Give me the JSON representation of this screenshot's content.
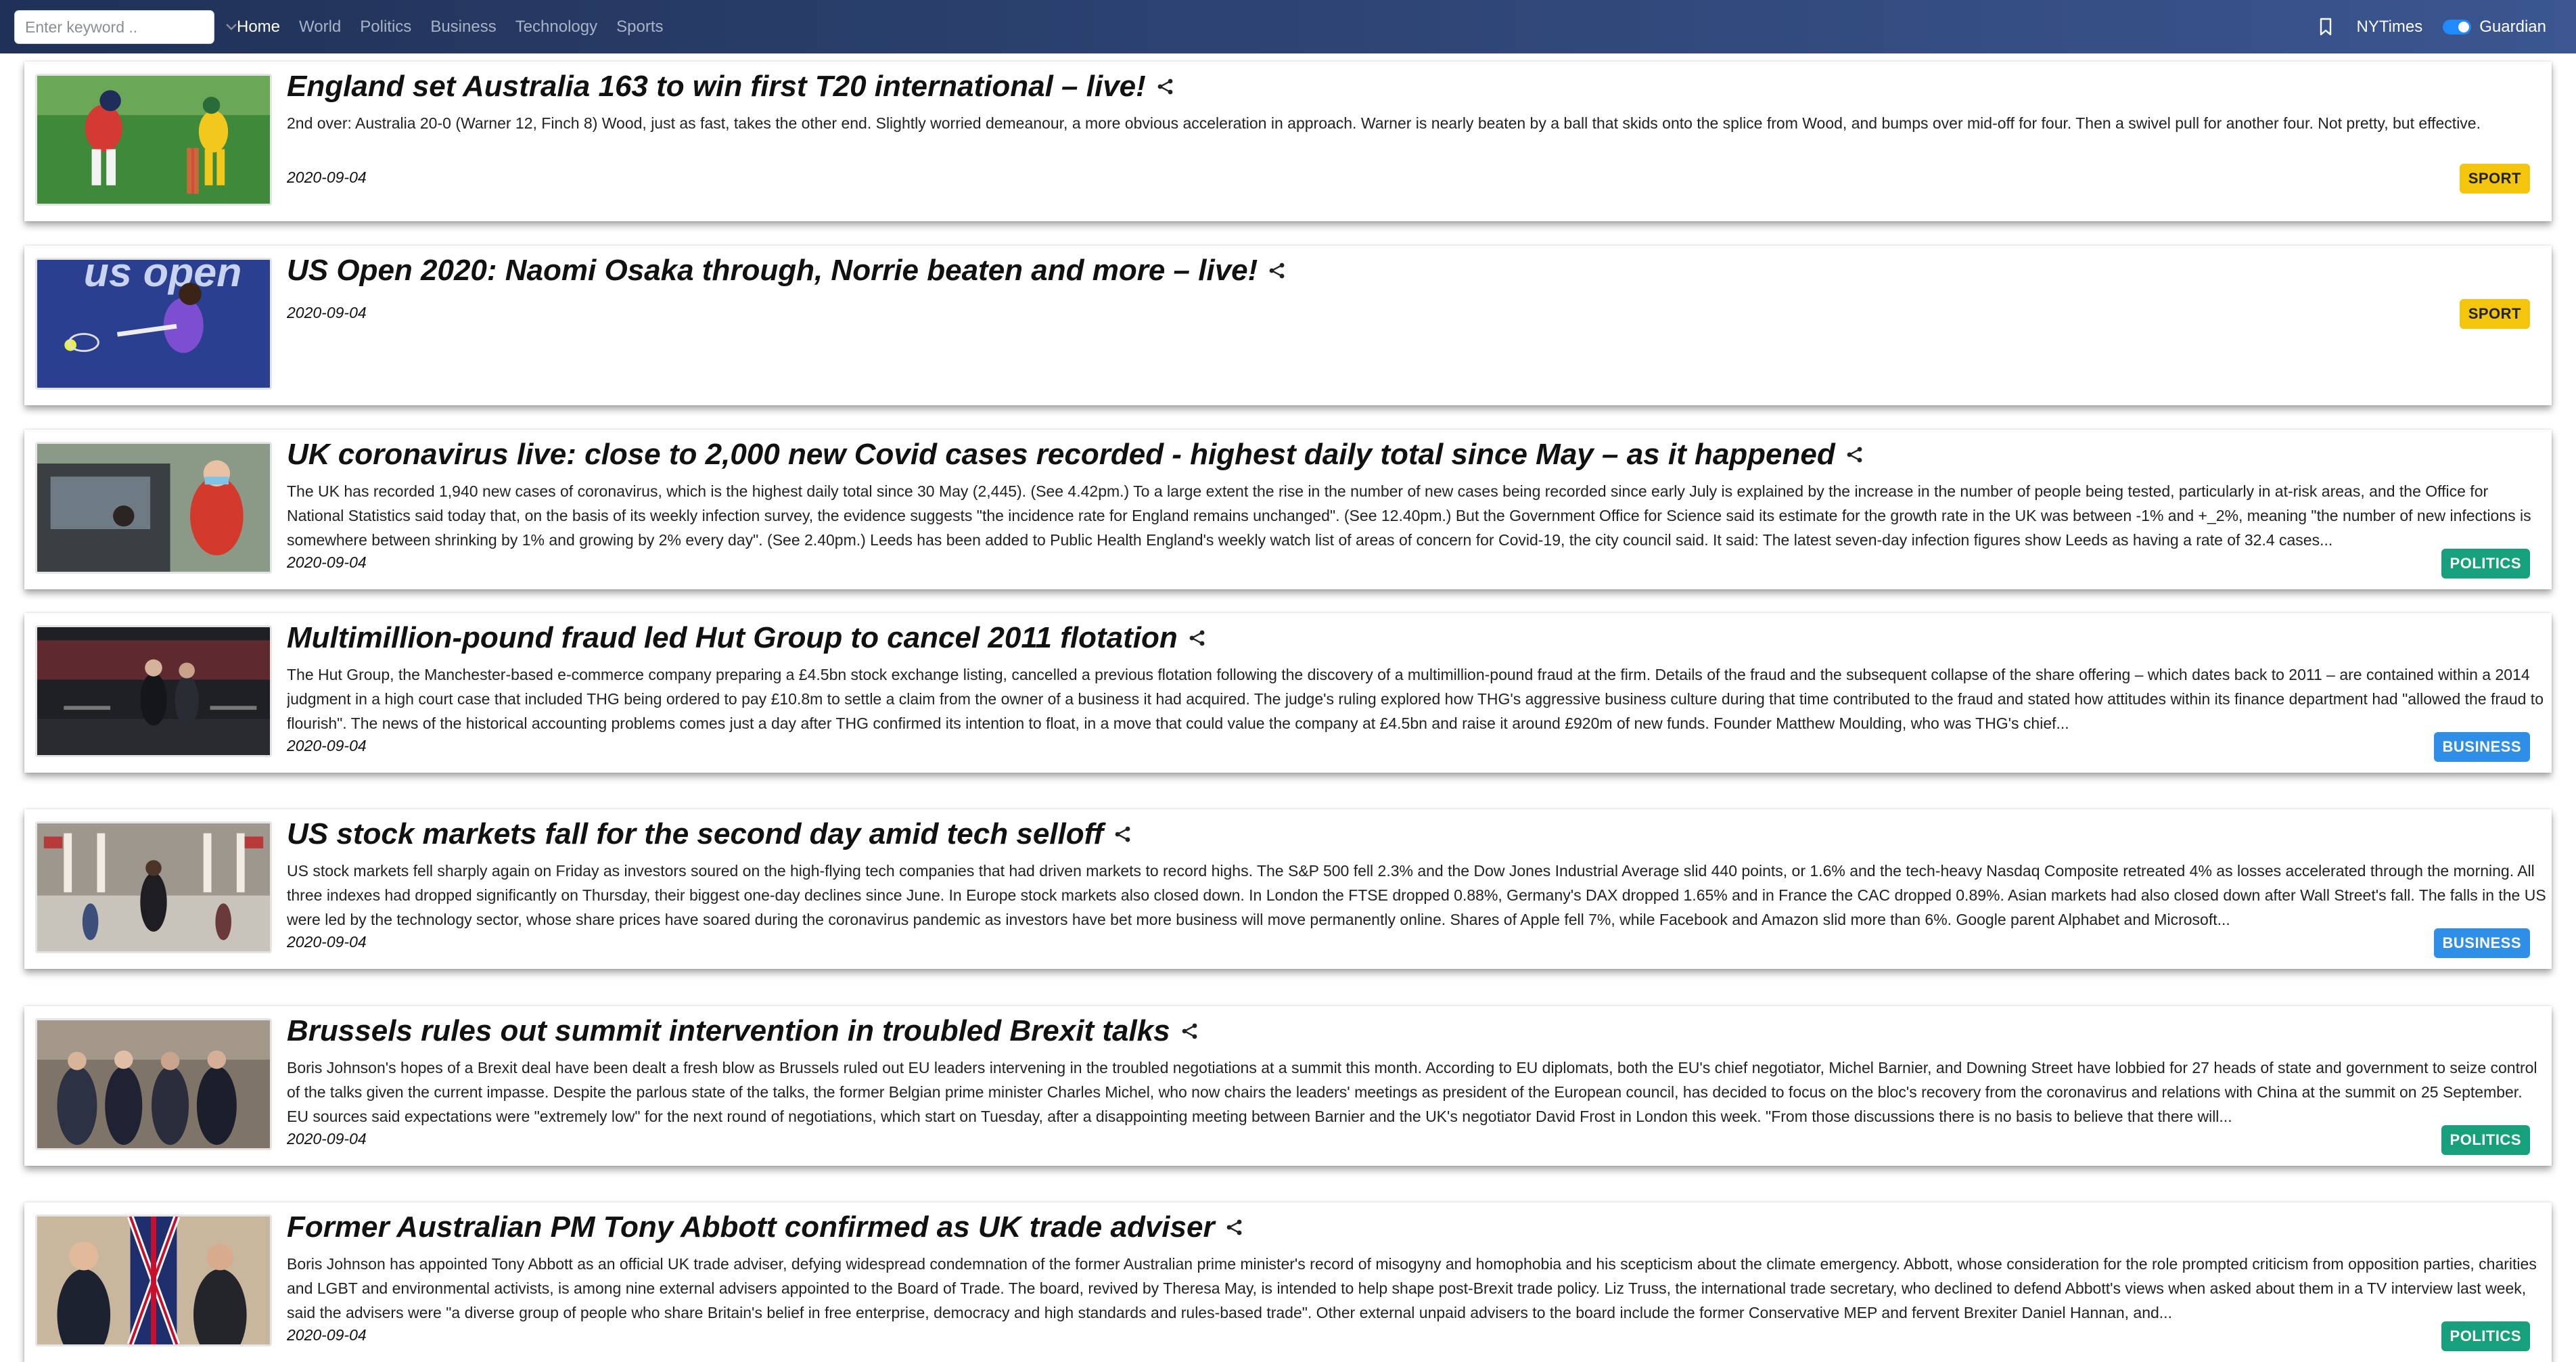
{
  "navbar": {
    "search_placeholder": "Enter keyword ..",
    "links": [
      "Home",
      "World",
      "Politics",
      "Business",
      "Technology",
      "Sports"
    ],
    "active": "Home",
    "source_left": "NYTimes",
    "source_right": "Guardian",
    "toggle_state": "Guardian"
  },
  "colors": {
    "navbar_left": "#1f3156",
    "navbar_right": "#3b5690",
    "sport": "#f3c60d",
    "politics": "#16a07c",
    "business": "#2f8ee6",
    "toggle": "#1f8bff"
  },
  "articles": [
    {
      "title": "England set Australia 163 to win first T20 international – live!",
      "description": "2nd over: Australia 20-0 (Warner 12, Finch 8) Wood, just as fast, takes the other end. Slightly worried demeanour, a more obvious acceleration in approach. Warner is nearly beaten by a ball that skids onto the splice from Wood, and bumps over mid-off for four. Then a swivel pull for another four. Not pretty, but effective.",
      "date": "2020-09-04",
      "section": "SPORT"
    },
    {
      "title": "US Open 2020: Naomi Osaka through, Norrie beaten and more – live!",
      "description": "",
      "date": "2020-09-04",
      "section": "SPORT"
    },
    {
      "title": "UK coronavirus live: close to 2,000 new Covid cases recorded - highest daily total since May – as it happened",
      "description": "The UK has recorded 1,940 new cases of coronavirus, which is the highest daily total since 30 May (2,445). (See 4.42pm.) To a large extent the rise in the number of new cases being recorded since early July is explained by the increase in the number of people being tested, particularly in at-risk areas, and the Office for National Statistics said today that, on the basis of its weekly infection survey, the evidence suggests \"the incidence rate for England remains unchanged\". (See 12.40pm.) But the Government Office for Science said its estimate for the growth rate in the UK was between -1% and +_2%, meaning \"the number of new infections is somewhere between shrinking by 1% and growing by 2% every day\". (See 2.40pm.) Leeds has been added to Public Health England's weekly watch list of areas of concern for Covid-19, the city council said. It said: The latest seven-day infection figures show Leeds as having a rate of 32.4 cases...",
      "date": "2020-09-04",
      "section": "POLITICS"
    },
    {
      "title": "Multimillion-pound fraud led Hut Group to cancel 2011 flotation",
      "description": "The Hut Group, the Manchester-based e-commerce company preparing a £4.5bn stock exchange listing, cancelled a previous flotation following the discovery of a multimillion-pound fraud at the firm. Details of the fraud and the subsequent collapse of the share offering – which dates back to 2011 – are contained within a 2014 judgment in a high court case that included THG being ordered to pay £10.8m to settle a claim from the owner of a business it had acquired. The judge's ruling explored how THG's aggressive business culture during that time contributed to the fraud and stated how attitudes within its finance department had \"allowed the fraud to flourish\". The news of the historical accounting problems comes just a day after THG confirmed its intention to float, in a move that could value the company at £4.5bn and raise it around £920m of new funds. Founder Matthew Moulding, who was THG's chief...",
      "date": "2020-09-04",
      "section": "BUSINESS"
    },
    {
      "title": "US stock markets fall for the second day amid tech selloff",
      "description": "US stock markets fell sharply again on Friday as investors soured on the high-flying tech companies that had driven markets to record highs. The S&P 500 fell 2.3% and the Dow Jones Industrial Average slid 440 points, or 1.6% and the tech-heavy Nasdaq Composite retreated 4% as losses accelerated through the morning. All three indexes had dropped significantly on Thursday, their biggest one-day declines since June. In Europe stock markets also closed down. In London the FTSE dropped 0.88%, Germany's DAX dropped 1.65% and in France the CAC dropped 0.89%. Asian markets had also closed down after Wall Street's fall. The falls in the US were led by the technology sector, whose share prices have soared during the coronavirus pandemic as investors have bet more business will move permanently online. Shares of Apple fell 7%, while Facebook and Amazon slid more than 6%. Google parent Alphabet and Microsoft...",
      "date": "2020-09-04",
      "section": "BUSINESS"
    },
    {
      "title": "Brussels rules out summit intervention in troubled Brexit talks",
      "description": "Boris Johnson's hopes of a Brexit deal have been dealt a fresh blow as Brussels ruled out EU leaders intervening in the troubled negotiations at a summit this month. According to EU diplomats, both the EU's chief negotiator, Michel Barnier, and Downing Street have lobbied for 27 heads of state and government to seize control of the talks given the current impasse. Despite the parlous state of the talks, the former Belgian prime minister Charles Michel, who now chairs the leaders' meetings as president of the European council, has decided to focus on the bloc's recovery from the coronavirus and relations with China at the summit on 25 September. EU sources said expectations were \"extremely low\" for the next round of negotiations, which start on Tuesday, after a disappointing meeting between Barnier and the UK's negotiator David Frost in London this week. \"From those discussions there is no basis to believe that there will...",
      "date": "2020-09-04",
      "section": "POLITICS"
    },
    {
      "title": "Former Australian PM Tony Abbott confirmed as UK trade adviser",
      "description": "Boris Johnson has appointed Tony Abbott as an official UK trade adviser, defying widespread condemnation of the former Australian prime minister's record of misogyny and homophobia and his scepticism about the climate emergency. Abbott, whose consideration for the role prompted criticism from opposition parties, charities and LGBT and environmental activists, is among nine external advisers appointed to the Board of Trade. The board, revived by Theresa May, is intended to help shape post-Brexit trade policy. Liz Truss, the international trade secretary, who declined to defend Abbott's views when asked about them in a TV interview last week, said the advisers were \"a diverse group of people who share Britain's belief in free enterprise, democracy and high standards and rules-based trade\". Other external unpaid advisers to the board include the former Conservative MEP and fervent Brexiter Daniel Hannan, and...",
      "date": "2020-09-04",
      "section": "POLITICS"
    }
  ]
}
